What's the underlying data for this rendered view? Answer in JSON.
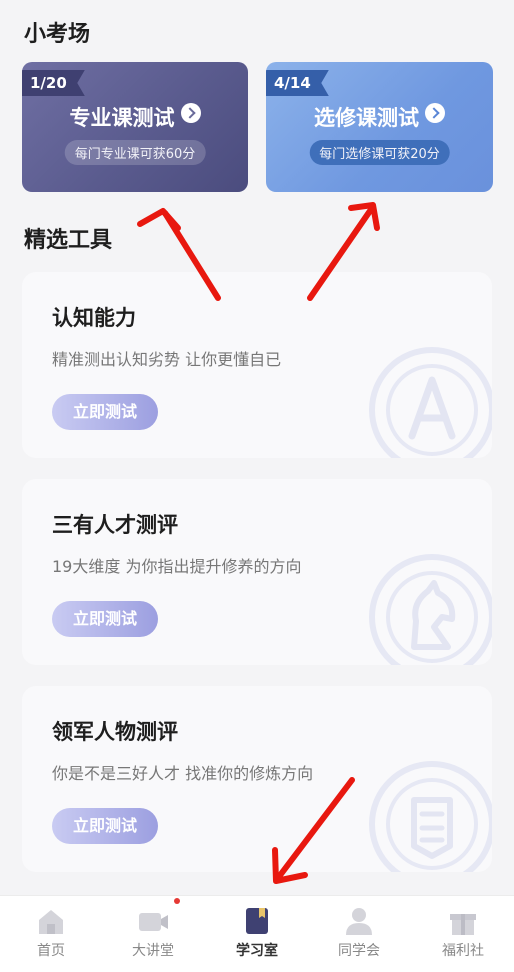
{
  "sections": {
    "exam_title": "小考场",
    "tools_title": "精选工具"
  },
  "exam_cards": [
    {
      "badge": "1/20",
      "title": "专业课测试",
      "subtitle": "每门专业课可获60分"
    },
    {
      "badge": "4/14",
      "title": "选修课测试",
      "subtitle": "每门选修课可获20分"
    }
  ],
  "tools": [
    {
      "name": "认知能力",
      "desc": "精准测出认知劣势 让你更懂自已",
      "button": "立即测试",
      "icon": "letter-a-badge-icon"
    },
    {
      "name": "三有人才测评",
      "desc": "19大维度 为你指出提升修养的方向",
      "button": "立即测试",
      "icon": "horse-chess-icon"
    },
    {
      "name": "领军人物测评",
      "desc": "你是不是三好人才 找准你的修炼方向",
      "button": "立即测试",
      "icon": "shield-badge-icon"
    }
  ],
  "nav": [
    {
      "label": "首页",
      "icon": "home-icon",
      "active": false
    },
    {
      "label": "大讲堂",
      "icon": "video-camera-icon",
      "active": false,
      "dot": true
    },
    {
      "label": "学习室",
      "icon": "book-icon",
      "active": true
    },
    {
      "label": "同学会",
      "icon": "user-icon",
      "active": false
    },
    {
      "label": "福利社",
      "icon": "gift-icon",
      "active": false
    }
  ],
  "colors": {
    "accent_purple": "#5a5b8e",
    "accent_blue": "#6f98e0",
    "annotation_red": "#e8180f"
  }
}
